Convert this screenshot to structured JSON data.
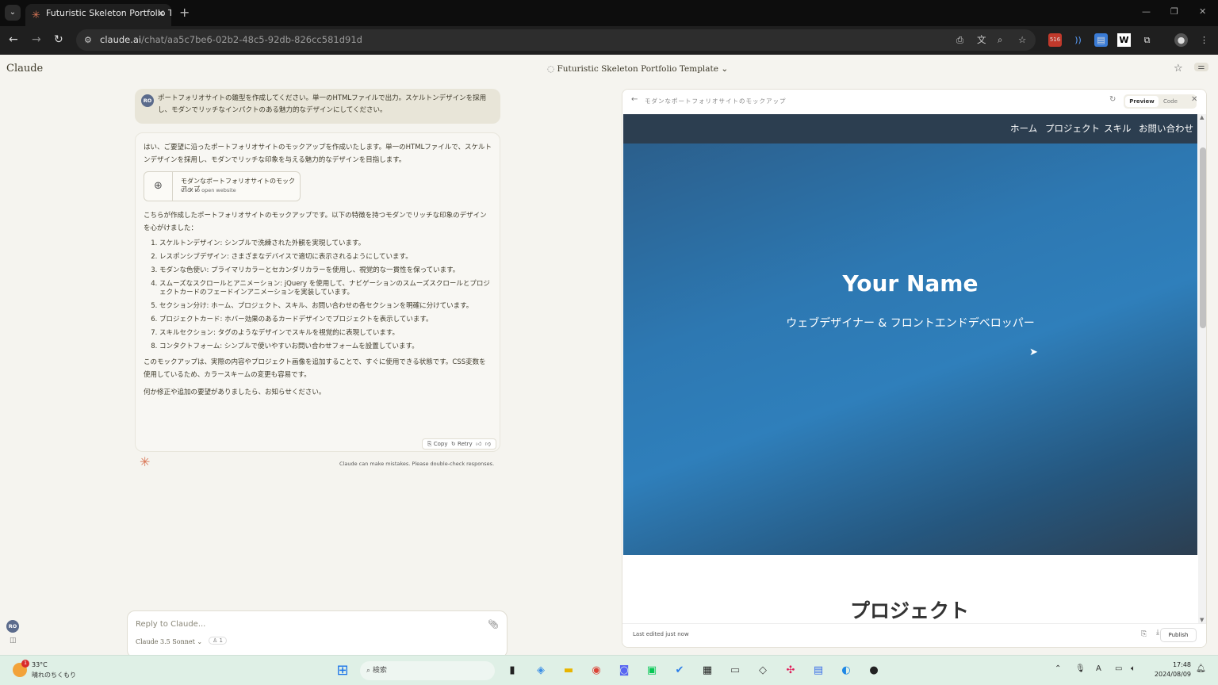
{
  "browser": {
    "tab_title": "Futuristic Skeleton Portfolio Ten",
    "url_host": "claude.ai",
    "url_path": "/chat/aa5c7be6-02b2-48c5-92db-826cc581d91d",
    "ext_badge": "516"
  },
  "app": {
    "logo": "Claude",
    "chat_title": "Futuristic Skeleton Portfolio Template ⌄"
  },
  "chat": {
    "user_avatar": "RO",
    "user_message": "ポートフォリオサイトの雛型を作成してください。単一のHTMLファイルで出力。スケルトンデザインを採用し、モダンでリッチなインパクトのある魅力的なデザインにしてください。",
    "reply_intro": "はい、ご要望に沿ったポートフォリオサイトのモックアップを作成いたします。単一のHTMLファイルで、スケルトンデザインを採用し、モダンでリッチな印象を与える魅力的なデザインを目指します。",
    "artifact_title": "モダンなポートフォリオサイトのモックアップ",
    "artifact_sub": "Click to open website",
    "reply_lead": "こちらが作成したポートフォリオサイトのモックアップです。以下の特徴を持つモダンでリッチな印象のデザインを心がけました：",
    "features": [
      "スケルトンデザイン: シンプルで洗練された外観を実現しています。",
      "レスポンシブデザイン: さまざまなデバイスで適切に表示されるようにしています。",
      "モダンな色使い: プライマリカラーとセカンダリカラーを使用し、視覚的な一貫性を保っています。",
      "スムーズなスクロールとアニメーション: jQuery を使用して、ナビゲーションのスムーズスクロールとプロジェクトカードのフェードインアニメーションを実装しています。",
      "セクション分け: ホーム、プロジェクト、スキル、お問い合わせの各セクションを明確に分けています。",
      "プロジェクトカード: ホバー効果のあるカードデザインでプロジェクトを表示しています。",
      "スキルセクション: タグのようなデザインでスキルを視覚的に表現しています。",
      "コンタクトフォーム: シンプルで使いやすいお問い合わせフォームを設置しています。"
    ],
    "reply_outro1": "このモックアップは、実際の内容やプロジェクト画像を追加することで、すぐに使用できる状態です。CSS変数を使用しているため、カラースキームの変更も容易です。",
    "reply_outro2": "何か修正や追加の要望がありましたら、お知らせください。",
    "copy": "Copy",
    "retry": "Retry",
    "disclaimer": "Claude can make mistakes. Please double-check responses.",
    "composer_placeholder": "Reply to Claude...",
    "model": "Claude 3.5 Sonnet ⌄",
    "attach_count": "1"
  },
  "artifact": {
    "title": "モダンなポートフォリオサイトのモックアップ",
    "preview": "Preview",
    "code": "Code",
    "nav": [
      "ホーム",
      "プロジェクト",
      "スキル",
      "お問い合わせ"
    ],
    "hero_name": "Your Name",
    "hero_sub": "ウェブデザイナー & フロントエンドデベロッパー",
    "section": "プロジェクト",
    "edited": "Last edited just now",
    "publish": "Publish"
  },
  "taskbar": {
    "temp": "33°C",
    "weather": "晴れのちくもり",
    "weather_badge": "1",
    "search": "検索",
    "time": "17:48",
    "date": "2024/08/09"
  }
}
